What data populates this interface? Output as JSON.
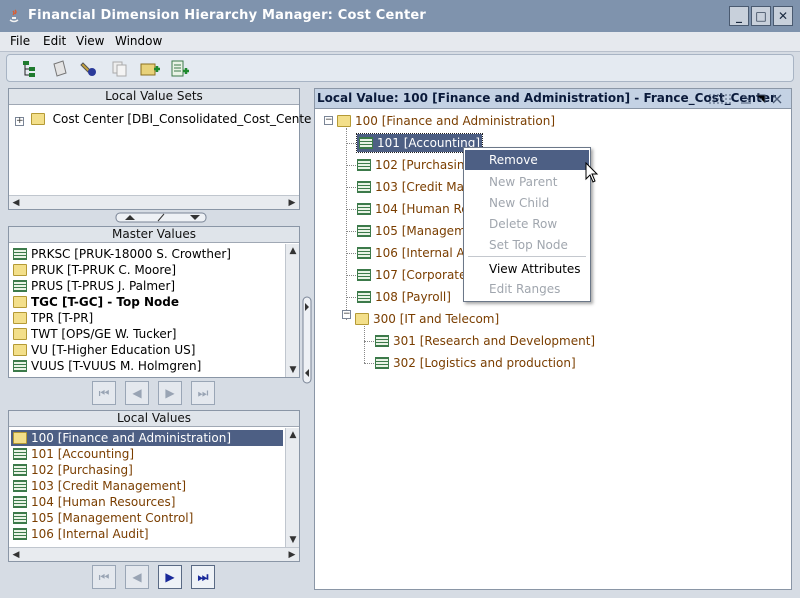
{
  "window": {
    "title": "Financial Dimension Hierarchy Manager: Cost Center",
    "minimize": "_",
    "maximize": "□",
    "close": "✕"
  },
  "menu": [
    "File",
    "Edit",
    "View",
    "Window"
  ],
  "toolbar_icons": [
    "hierarchy-icon",
    "notepad-icon",
    "flashlight-icon",
    "copy-icon",
    "add-folder-icon",
    "add-document-icon"
  ],
  "local_value_sets": {
    "title": "Local Value Sets",
    "items": [
      {
        "label": "Cost Center  [DBI_Consolidated_Cost_Cente"
      }
    ]
  },
  "master_values": {
    "title": "Master Values",
    "items": [
      {
        "label": "PRKSC  [PRUK-18000  S. Crowther]",
        "icon": "leaf",
        "bold": false
      },
      {
        "label": "PRUK  [T-PRUK  C. Moore]",
        "icon": "folder",
        "bold": false
      },
      {
        "label": "PRUS  [T-PRUS  J. Palmer]",
        "icon": "leaf",
        "bold": false
      },
      {
        "label": "TGC  [T-GC] - Top Node",
        "icon": "folder",
        "bold": true
      },
      {
        "label": "TPR  [T-PR]",
        "icon": "folder",
        "bold": false
      },
      {
        "label": "TWT  [OPS/GE W. Tucker]",
        "icon": "folder",
        "bold": false
      },
      {
        "label": "VU  [T-Higher Education US]",
        "icon": "folder",
        "bold": false
      },
      {
        "label": "VUUS  [T-VUUS M. Holmgren]",
        "icon": "leaf",
        "bold": false
      }
    ],
    "nav": [
      "⏮",
      "◀",
      "▶",
      "⏭"
    ]
  },
  "local_values": {
    "title": "Local Values",
    "items": [
      {
        "label": "100  [Finance and Administration]",
        "icon": "folder",
        "selected": true
      },
      {
        "label": "101  [Accounting]",
        "icon": "leaf",
        "selected": false
      },
      {
        "label": "102  [Purchasing]",
        "icon": "leaf",
        "selected": false
      },
      {
        "label": "103  [Credit Management]",
        "icon": "leaf",
        "selected": false
      },
      {
        "label": "104  [Human Resources]",
        "icon": "leaf",
        "selected": false
      },
      {
        "label": "105  [Management Control]",
        "icon": "leaf",
        "selected": false
      },
      {
        "label": "106  [Internal Audit]",
        "icon": "leaf",
        "selected": false
      }
    ],
    "nav": [
      "⏮",
      "◀",
      "▶",
      "⏭"
    ]
  },
  "hierarchy": {
    "header": "Local Value: 100 [Finance and Administration] - France_Cost_Center",
    "root": "100 [Finance and Administration]",
    "children": [
      "101 [Accounting]",
      "102 [Purchasing",
      "103 [Credit Mana",
      "104 [Human Res",
      "105 [Manageme",
      "106 [Internal Aud",
      "107 [Corporate S",
      "108 [Payroll]"
    ],
    "node300": "300 [IT and Telecom]",
    "children300": [
      "301 [Research and Development]",
      "302 [Logistics and production]"
    ]
  },
  "context_menu": {
    "items": [
      {
        "label": "Remove",
        "enabled": true
      },
      {
        "label": "New Parent",
        "enabled": false
      },
      {
        "label": "New Child",
        "enabled": false
      },
      {
        "label": "Delete Row",
        "enabled": false
      },
      {
        "label": "Set Top Node",
        "enabled": false
      },
      {
        "label": "View Attributes",
        "enabled": true
      },
      {
        "label": "Edit Ranges",
        "enabled": false
      }
    ]
  },
  "colors": {
    "accent": "#4d5f84",
    "value_text": "#7a3e00",
    "selection": "#4d5f84"
  }
}
